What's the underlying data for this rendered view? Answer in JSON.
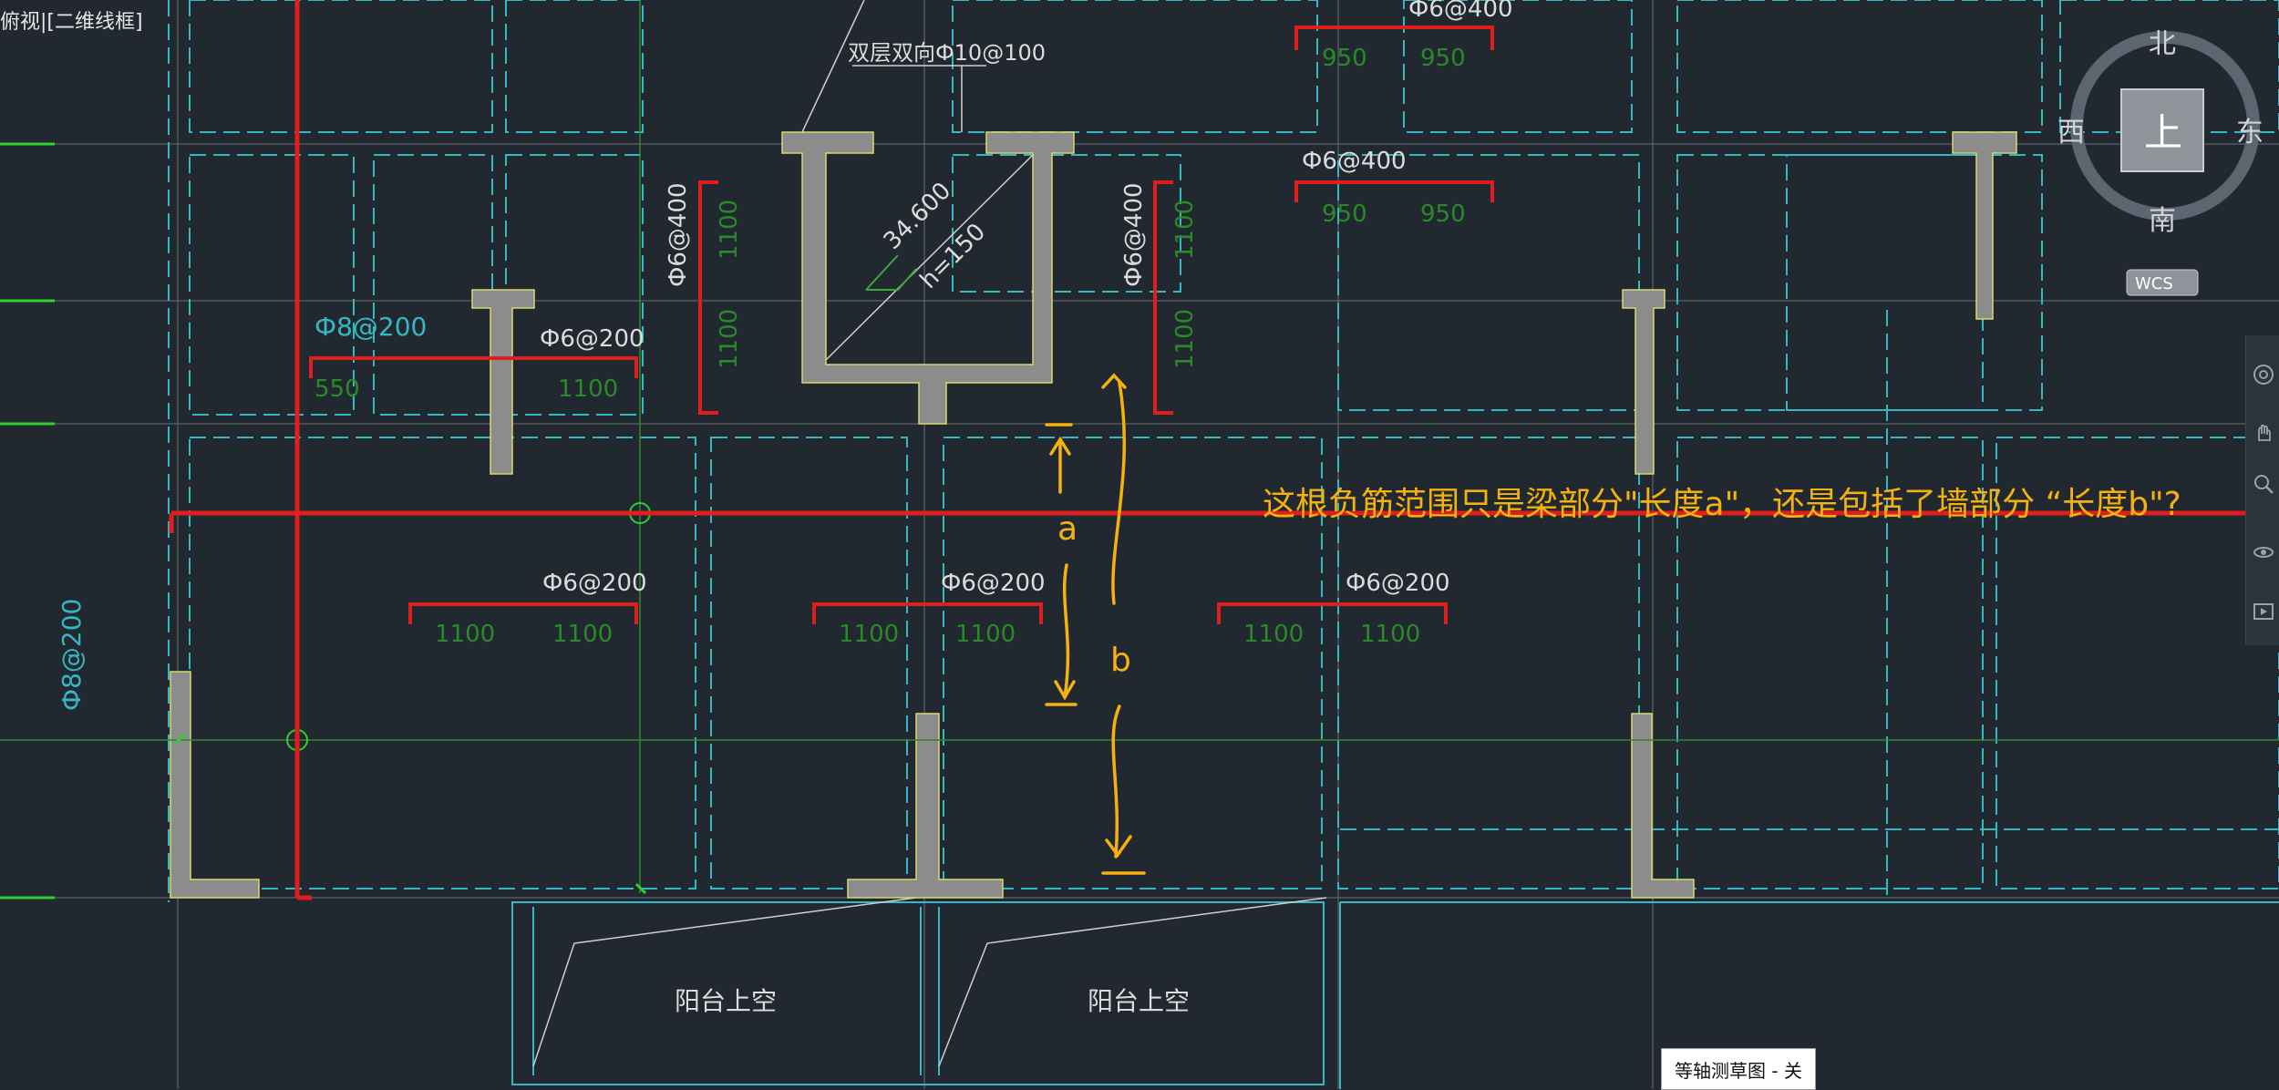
{
  "view_label": "俯视|[二维线框]",
  "viewcube": {
    "north": "北",
    "south": "南",
    "east": "东",
    "west": "西",
    "top": "上",
    "wcs": "WCS"
  },
  "annotations": {
    "double_rebar": "双层双向Ф10@100",
    "elevation": "34.600",
    "thickness": "h=150",
    "r_top1": "Ф6@400",
    "r_top2": "Ф6@400",
    "r_left": "Ф8@200",
    "r_mid_top": "Ф6@200",
    "r_vert_left": "Ф6@400",
    "r_vert_right": "Ф6@400",
    "r_side_left": "Ф8@200",
    "r_bot1": "Ф6@200",
    "r_bot2": "Ф6@200",
    "r_bot3": "Ф6@200",
    "d_950a": "950",
    "d_950b": "950",
    "d_950c": "950",
    "d_950d": "950",
    "d_550": "550",
    "d_1100_mid": "1100",
    "d_v1100a": "1100",
    "d_v1100b": "1100",
    "d_v1100c": "1100",
    "d_v1100d": "1100",
    "d_b1a": "1100",
    "d_b1b": "1100",
    "d_b2a": "1100",
    "d_b2b": "1100",
    "d_b3a": "1100",
    "d_b3b": "1100",
    "balcony1": "阳台上空",
    "balcony2": "阳台上空",
    "label_a": "a",
    "label_b": "b",
    "question": "这根负筋范围只是梁部分\"长度a\"，还是包括了墙部分 “长度b\"?"
  },
  "status_popup": "等轴测草图 - 关",
  "colors": {
    "background": "#212830",
    "cyan": "#36b7c4",
    "red": "#e01e1e",
    "orange": "#f5b20f",
    "green": "#2a8a2a",
    "wall": "#8c8c8c"
  }
}
